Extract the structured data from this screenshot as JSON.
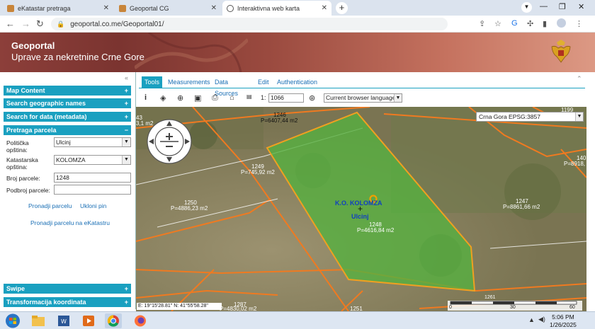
{
  "browser": {
    "tabs": [
      {
        "title": "eKatastar pretraga",
        "active": false
      },
      {
        "title": "Geoportal CG",
        "active": false
      },
      {
        "title": "Interaktivna web karta",
        "active": true
      }
    ],
    "url_host": "geoportal.co.me/Geoportal01/"
  },
  "banner": {
    "line1": "Geoportal",
    "line2": "Uprave za nekretnine Crne Gore"
  },
  "left_panel": {
    "sections": {
      "map_content": "Map Content",
      "search_geo": "Search geographic names",
      "search_meta": "Search for data (metadata)",
      "pretraga": "Pretraga parcela",
      "swipe": "Swipe",
      "transform": "Transformacija koordinata"
    },
    "form": {
      "politicka_label": "Politička opština:",
      "politicka_value": "Ulcinj",
      "katastarska_label": "Katastarska opština:",
      "katastarska_value": "KOLOMZA",
      "broj_label": "Broj parcele:",
      "broj_value": "1248",
      "podbroj_label": "Podbroj parcele:",
      "podbroj_value": ""
    },
    "links": {
      "find": "Pronadji parcelu",
      "remove": "Ukloni pin",
      "ekatastar": "Pronadji parcelu na eKatastru"
    }
  },
  "tool_tabs": [
    "Tools",
    "Measurements",
    "Data Sources",
    "Edit",
    "Authentication"
  ],
  "toolbar": {
    "scale_prefix": "1:",
    "scale_value": "1066",
    "language": "Current browser language"
  },
  "map": {
    "crs": "Crna Gora EPSG:3857",
    "coords": "E: 19°15'28.81\"   N: 41°55'58.28\"",
    "labels": {
      "p1246": "1246",
      "p1246a": "P=6407,44 m2",
      "p1249": "1249",
      "p1249a": "P=745,92 m2",
      "p1250": "1250",
      "p1250a": "P=4886,23 m2",
      "p1247": "1247",
      "p1247a": "P=8861,66 m2",
      "ko": "K.O. KOLOMZA",
      "ulcinj": "Ulcinj",
      "p1248": "1248",
      "p1248a": "P=4616,84 m2",
      "p1287": "1287",
      "p1287a": "P=4830,02 m2",
      "p1251": "1251",
      "p1199": "1199",
      "p43": "43",
      "p43a": "3,1 m2",
      "p140": "140",
      "p140a": "P=8918,",
      "p1261": "1261",
      "scale0": "0",
      "scale30": "30",
      "scale60": "60"
    }
  },
  "taskbar": {
    "time": "5:06 PM",
    "date": "1/26/2025"
  },
  "colors": {
    "accent": "#1aa0c0",
    "parcel_fill": "#56b040",
    "parcel_border": "#f0a020"
  }
}
